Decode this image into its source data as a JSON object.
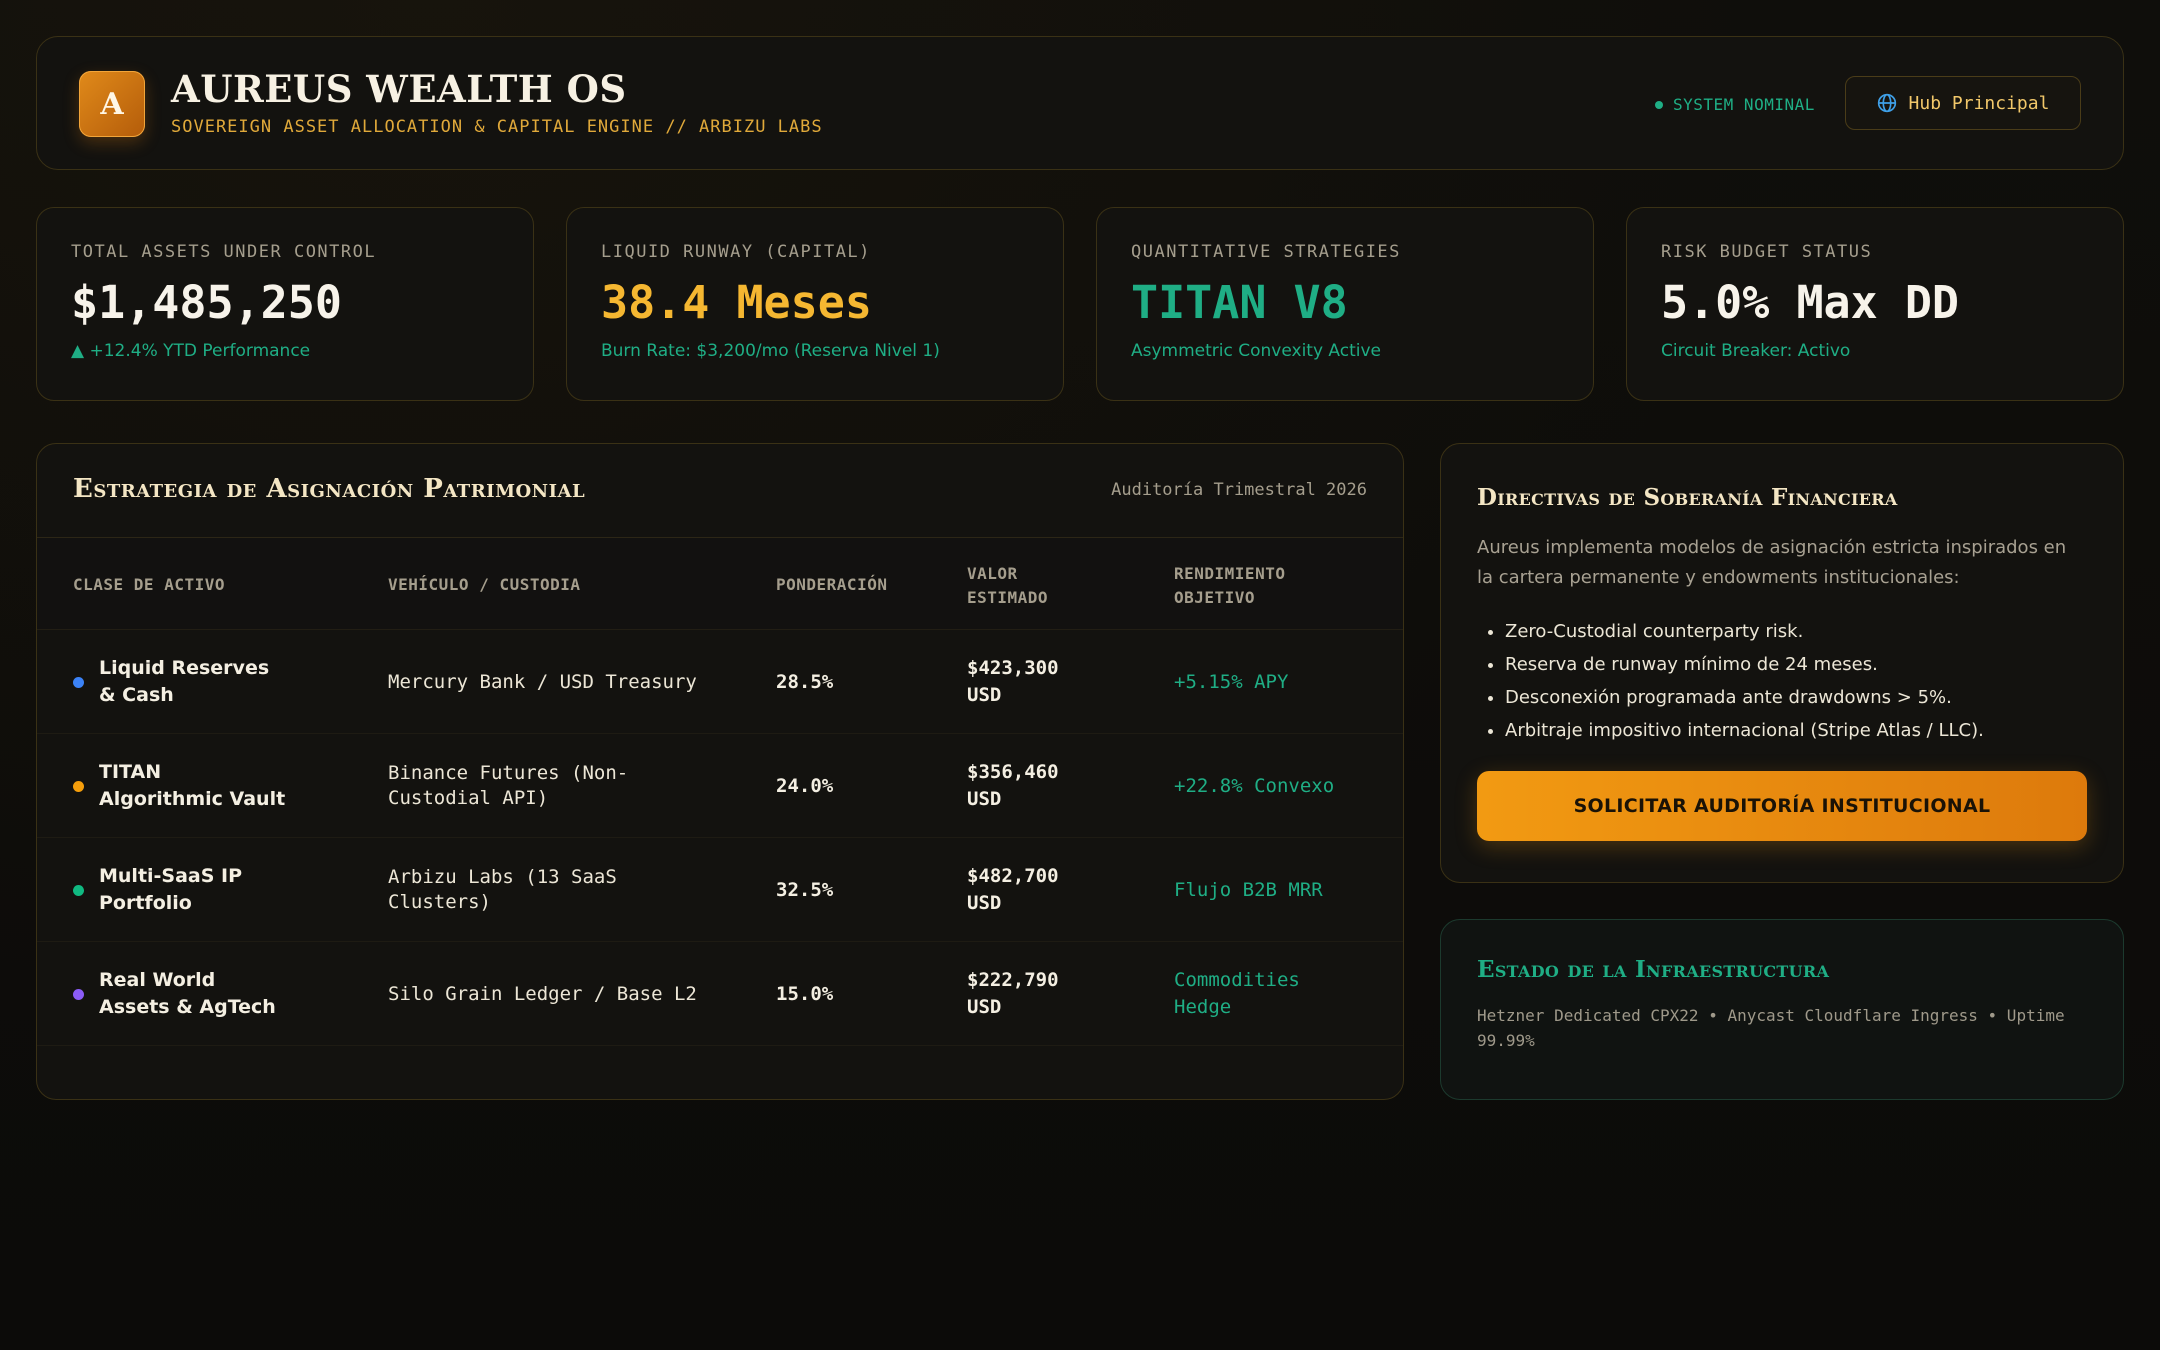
{
  "header": {
    "logo_letter": "A",
    "title": "AUREUS WEALTH OS",
    "subtitle": "SOVEREIGN ASSET ALLOCATION & CAPITAL ENGINE // ARBIZU LABS",
    "system_status": "SYSTEM NOMINAL",
    "hub_button": "Hub Principal",
    "hub_icon": "globe-icon"
  },
  "kpis": [
    {
      "label": "TOTAL ASSETS UNDER CONTROL",
      "value": "$1,485,250",
      "sub": "▲ +12.4% YTD Performance",
      "color": "#f7f3ea"
    },
    {
      "label": "LIQUID RUNWAY (CAPITAL)",
      "value": "38.4 Meses",
      "sub": "Burn Rate: $3,200/mo (Reserva Nivel 1)",
      "color": "#f5b731"
    },
    {
      "label": "QUANTITATIVE STRATEGIES",
      "value": "TITAN V8",
      "sub": "Asymmetric Convexity Active",
      "color": "#1fae85"
    },
    {
      "label": "RISK BUDGET STATUS",
      "value": "5.0% Max DD",
      "sub": "Circuit Breaker: Activo",
      "color": "#f7f3ea"
    }
  ],
  "allocation": {
    "title": "Estrategia de Asignación Patrimonial",
    "audit": "Auditoría Trimestral 2026",
    "columns": [
      "CLASE DE ACTIVO",
      "VEHÍCULO / CUSTODIA",
      "PONDERACIÓN",
      "VALOR ESTIMADO",
      "RENDIMIENTO OBJETIVO"
    ],
    "rows": [
      {
        "asset": "Liquid Reserves & Cash",
        "dot_color": "#3b82f6",
        "vehicle": "Mercury Bank / USD Treasury",
        "weight": "28.5%",
        "value": "$423,300 USD",
        "yield": "+5.15% APY"
      },
      {
        "asset": "TITAN Algorithmic Vault",
        "dot_color": "#f59e0b",
        "vehicle": "Binance Futures (Non-Custodial API)",
        "weight": "24.0%",
        "value": "$356,460 USD",
        "yield": "+22.8% Convexo"
      },
      {
        "asset": "Multi-SaaS IP Portfolio",
        "dot_color": "#10b981",
        "vehicle": "Arbizu Labs (13 SaaS Clusters)",
        "weight": "32.5%",
        "value": "$482,700 USD",
        "yield": "Flujo B2B MRR"
      },
      {
        "asset": "Real World Assets & AgTech",
        "dot_color": "#8b5cf6",
        "vehicle": "Silo Grain Ledger / Base L2",
        "weight": "15.0%",
        "value": "$222,790 USD",
        "yield": "Commodities Hedge"
      }
    ]
  },
  "directives": {
    "title": "Directivas de Soberanía Financiera",
    "description": "Aureus implementa modelos de asignación estricta inspirados en la cartera permanente y endowments institucionales:",
    "items": [
      "Zero-Custodial counterparty risk.",
      "Reserva de runway mínimo de 24 meses.",
      "Desconexión programada ante drawdowns > 5%.",
      "Arbitraje impositivo internacional (Stripe Atlas / LLC)."
    ],
    "cta": "SOLICITAR AUDITORÍA INSTITUCIONAL"
  },
  "infra": {
    "title": "Estado de la Infraestructura",
    "text": "Hetzner Dedicated CPX22 • Anycast Cloudflare Ingress • Uptime 99.99%"
  },
  "colors": {
    "accent_gold": "#f5b731",
    "accent_green": "#1fae85",
    "cta_orange": "#f29a12"
  }
}
